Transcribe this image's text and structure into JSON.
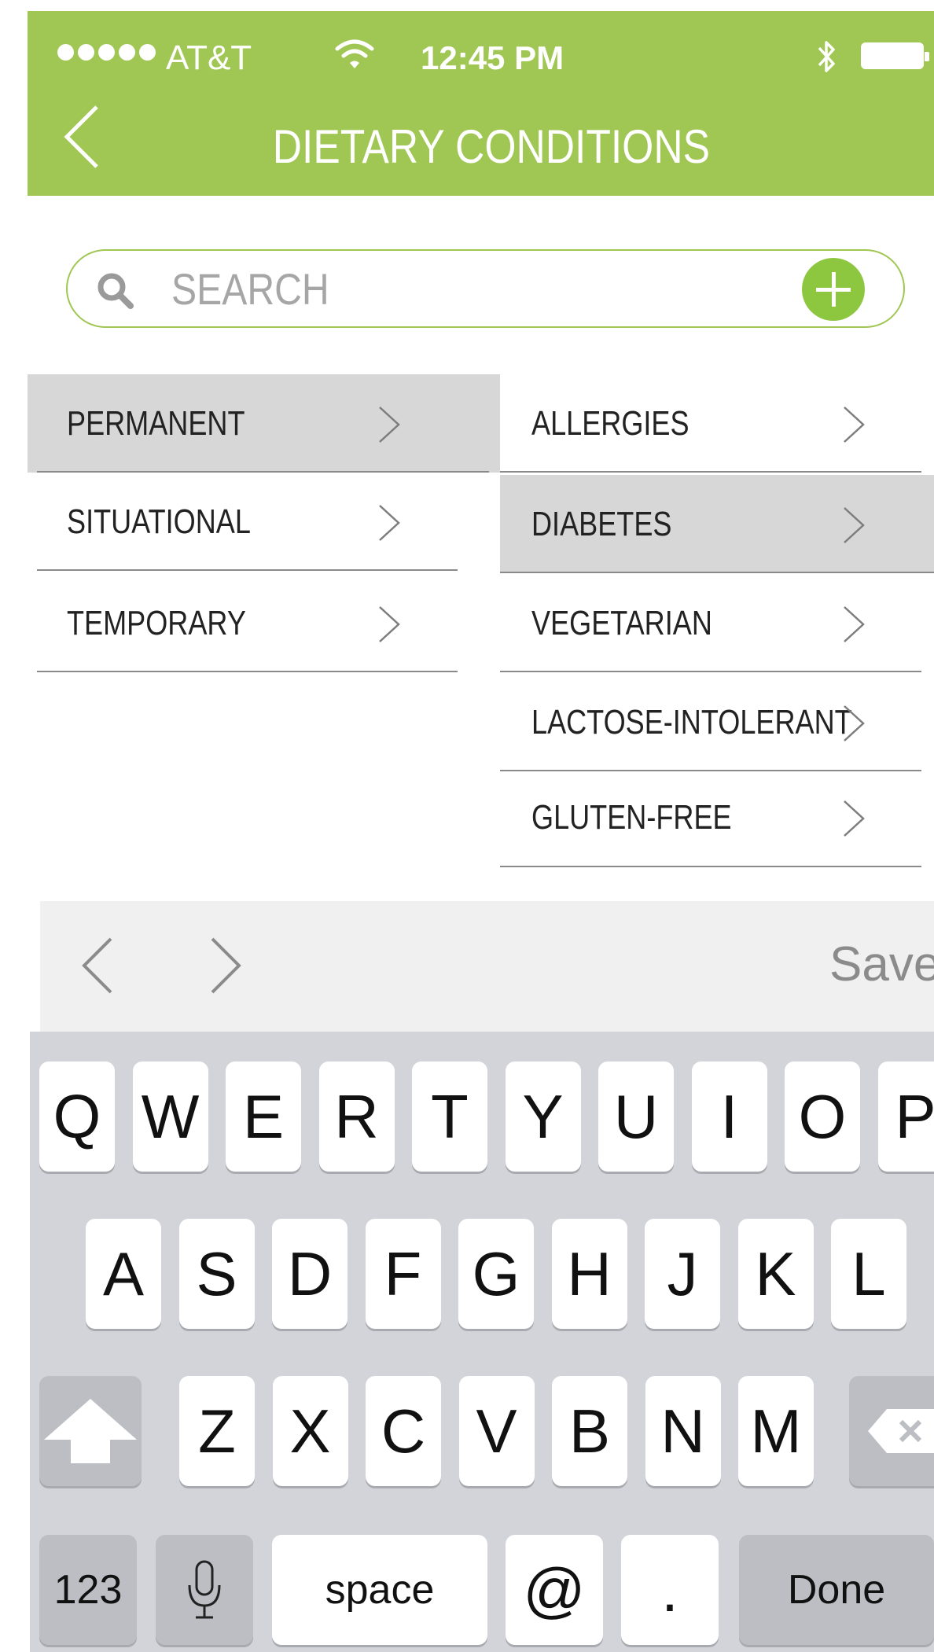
{
  "status_bar": {
    "carrier": "AT&T",
    "time": "12:45 PM"
  },
  "header": {
    "title": "DIETARY CONDITIONS"
  },
  "search": {
    "placeholder": "SEARCH"
  },
  "categories": [
    {
      "label": "PERMANENT",
      "selected": true
    },
    {
      "label": "SITUATIONAL",
      "selected": false
    },
    {
      "label": "TEMPORARY",
      "selected": false
    }
  ],
  "conditions": [
    {
      "label": "ALLERGIES",
      "selected": false
    },
    {
      "label": "DIABETES",
      "selected": true
    },
    {
      "label": "VEGETARIAN",
      "selected": false
    },
    {
      "label": "LACTOSE-INTOLERANT",
      "selected": false
    },
    {
      "label": "GLUTEN-FREE",
      "selected": false
    }
  ],
  "accessory_bar": {
    "save_label": "Save"
  },
  "keyboard": {
    "row1": [
      "Q",
      "W",
      "E",
      "R",
      "T",
      "Y",
      "U",
      "I",
      "O",
      "P"
    ],
    "row2": [
      "A",
      "S",
      "D",
      "F",
      "G",
      "H",
      "J",
      "K",
      "L"
    ],
    "row3": [
      "Z",
      "X",
      "C",
      "V",
      "B",
      "N",
      "M"
    ],
    "numbers_label": "123",
    "space_label": "space",
    "at_label": "@",
    "period_label": ".",
    "done_label": "Done"
  },
  "colors": {
    "accent": "#a0c653",
    "add_button": "#8dc63f",
    "selected_row": "#d7d7d7",
    "keyboard_bg": "#d2d4d9"
  }
}
